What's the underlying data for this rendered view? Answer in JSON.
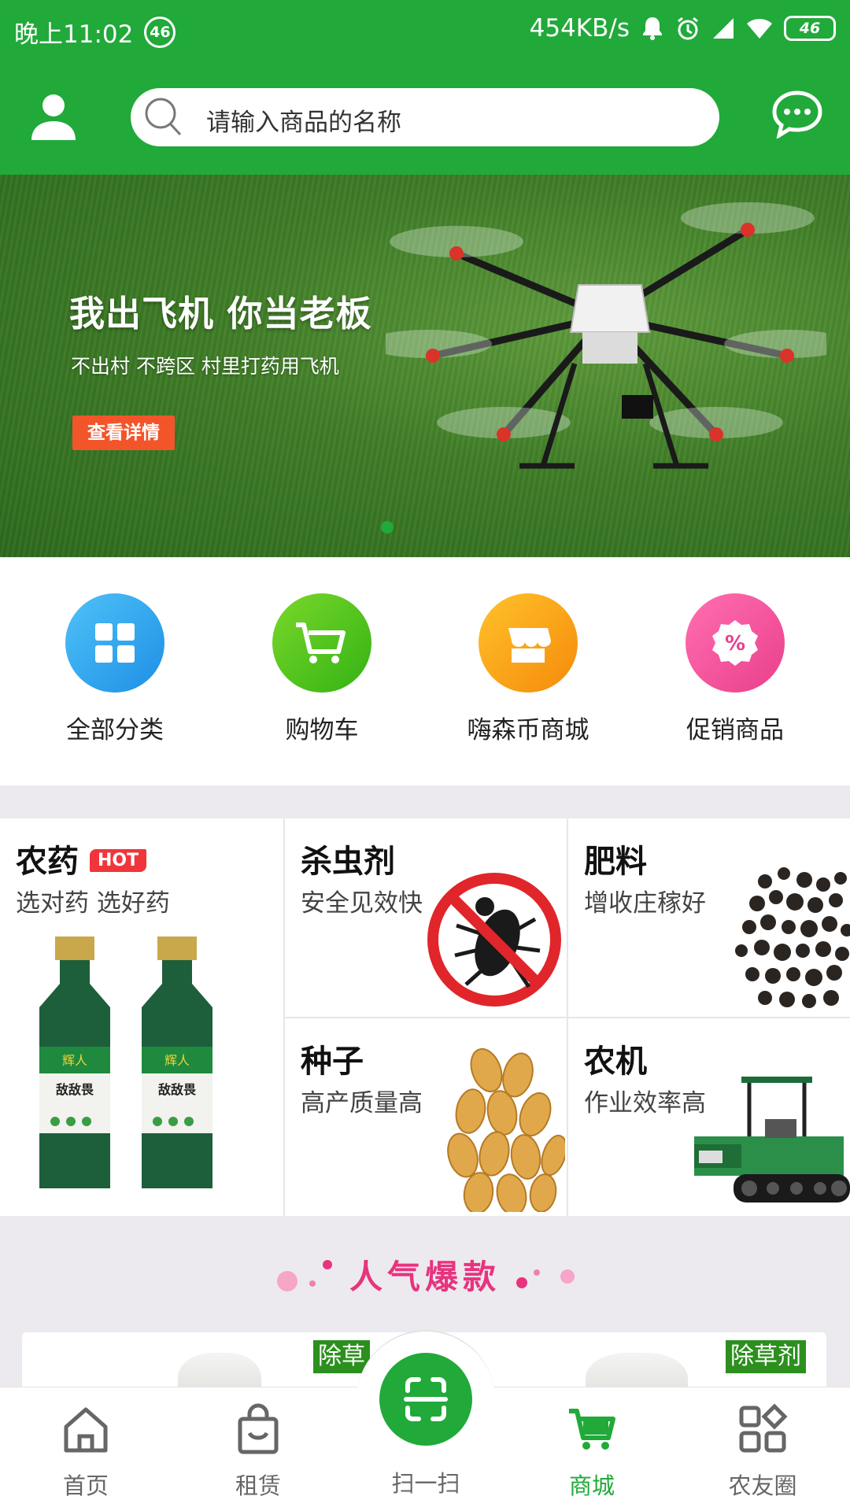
{
  "status_bar": {
    "time": "晚上11:02",
    "signal_badge": "46",
    "speed": "454KB/s",
    "battery": "46"
  },
  "header": {
    "search_placeholder": "请输入商品的名称"
  },
  "banner": {
    "title": "我出飞机 你当老板",
    "subtitle": "不出村 不跨区 村里打药用飞机",
    "cta": "查看详情"
  },
  "quick_nav": [
    {
      "label": "全部分类",
      "icon": "grid-icon",
      "color": "#2fa6f0"
    },
    {
      "label": "购物车",
      "icon": "cart-icon",
      "color": "#4fc61c"
    },
    {
      "label": "嗨森币商城",
      "icon": "store-icon",
      "color": "#f8a21a"
    },
    {
      "label": "促销商品",
      "icon": "discount-icon",
      "color": "#f04b98"
    }
  ],
  "categories": {
    "pesticide": {
      "title": "农药",
      "badge": "HOT",
      "subtitle": "选对药 选好药"
    },
    "insecticide": {
      "title": "杀虫剂",
      "subtitle": "安全见效快"
    },
    "fertilizer": {
      "title": "肥料",
      "subtitle": "增收庄稼好"
    },
    "seed": {
      "title": "种子",
      "subtitle": "高产质量高"
    },
    "machinery": {
      "title": "农机",
      "subtitle": "作业效率高"
    }
  },
  "bottle_label": {
    "brand": "辉人",
    "name": "敌敌畏"
  },
  "popular": {
    "title": "人气爆款",
    "tag_left": "除草",
    "tag_right": "除草剂"
  },
  "bottom_nav": {
    "home": "首页",
    "rent": "租赁",
    "scan": "扫一扫",
    "mall": "商城",
    "circle": "农友圈"
  },
  "colors": {
    "brand_green": "#21a93a",
    "hot_red": "#f0353c",
    "popular_pink": "#e8337e"
  }
}
